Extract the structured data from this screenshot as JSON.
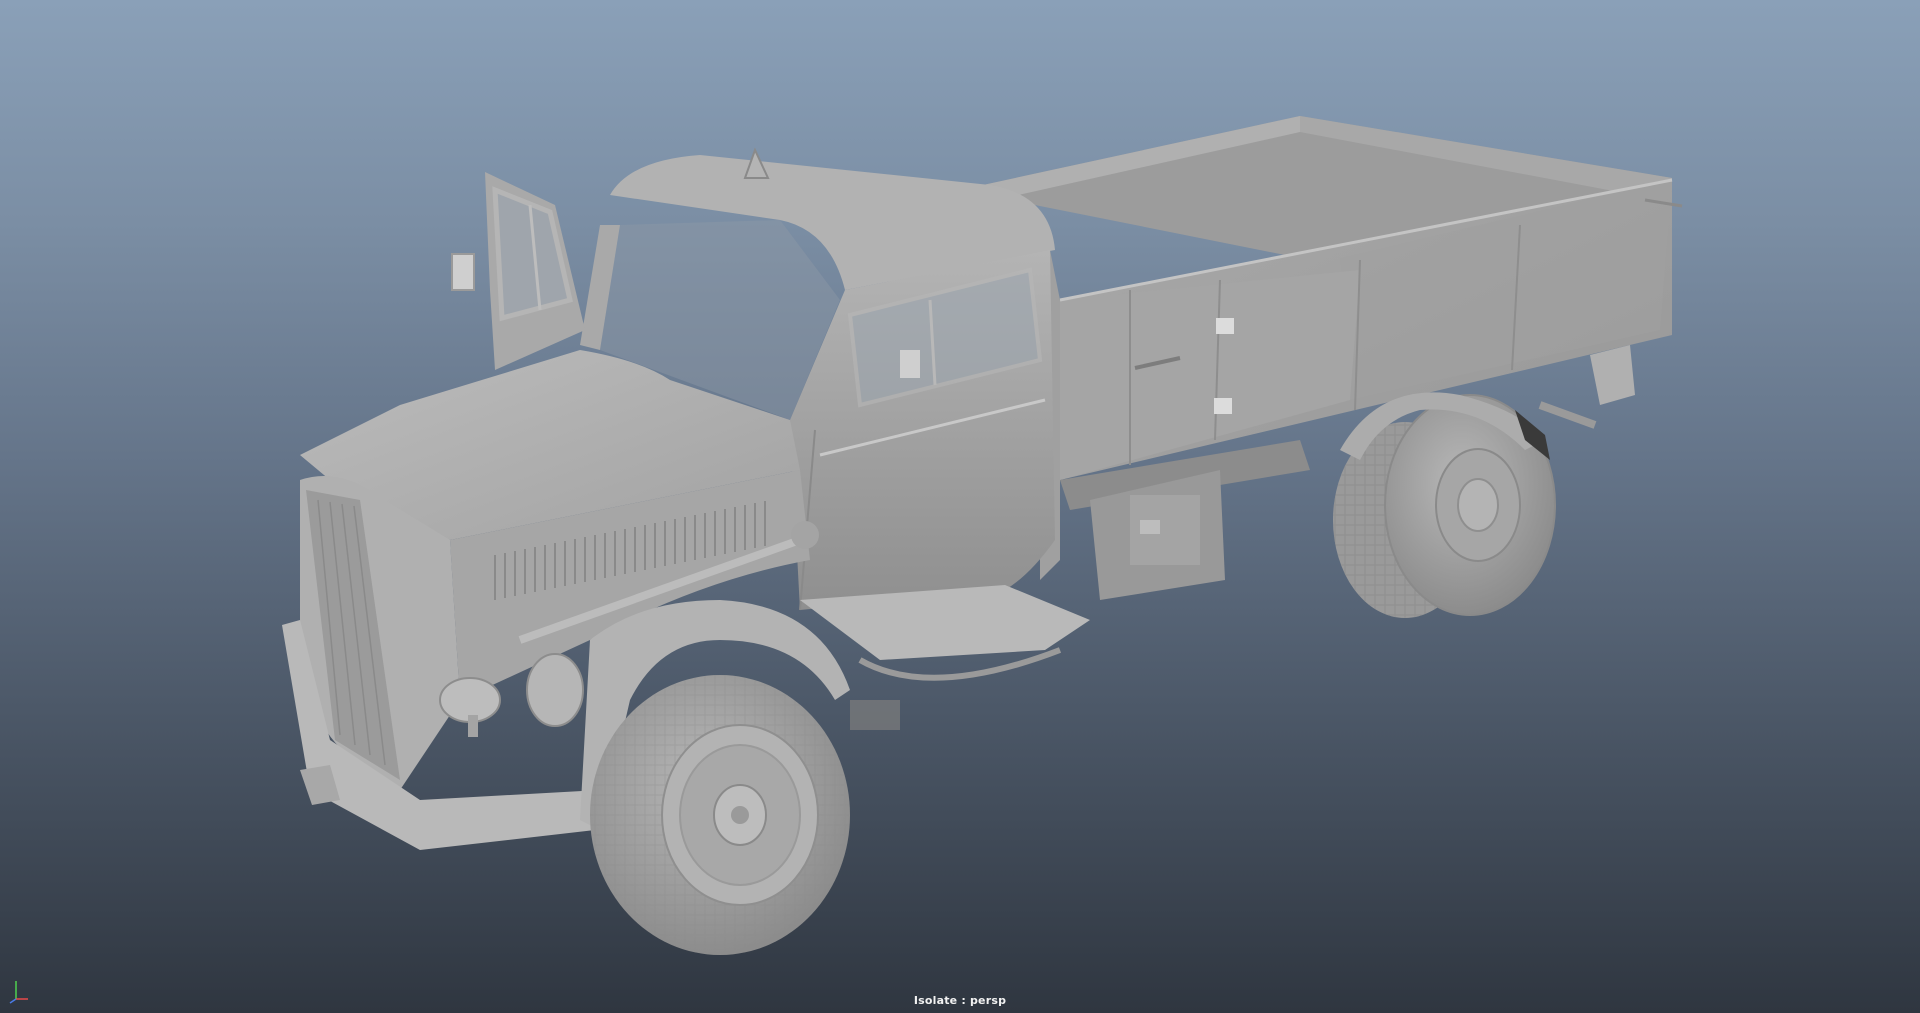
{
  "viewport": {
    "camera_label": "Isolate : persp",
    "object_name": "truck-model",
    "shading": "smooth-shaded-gray",
    "background_gradient": [
      "#8aa0b8",
      "#65758a",
      "#2f3640"
    ],
    "model_color": "#a6a6a6"
  },
  "icons": {
    "axis": "axis-gizmo-icon"
  }
}
